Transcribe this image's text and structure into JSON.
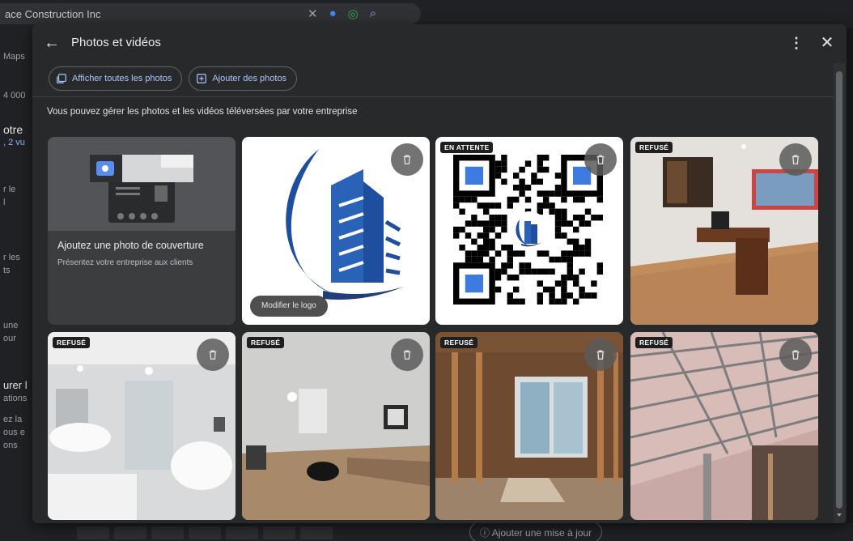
{
  "background": {
    "search_text": "ace Construction Inc",
    "left_fragments": [
      "Maps",
      "4 000",
      "otre",
      ", 2 vu",
      "r le",
      "l",
      "r les",
      "ts",
      "une",
      "our",
      "urer l",
      "ations",
      "ez la",
      "ous e",
      "ons"
    ],
    "bottom_button": "Ajouter une mise à jour"
  },
  "dialog": {
    "title": "Photos et vidéos",
    "chips": {
      "show_all": "Afficher toutes les photos",
      "add_photos": "Ajouter des photos"
    },
    "description": "Vous pouvez gérer les photos et les vidéos téléversées par votre entreprise",
    "cover": {
      "title": "Ajoutez une photo de couverture",
      "subtitle": "Présentez votre entreprise aux clients"
    },
    "logo_button": "Modifier le logo",
    "status": {
      "pending": "EN ATTENTE",
      "refused": "REFUSÉ"
    }
  },
  "colors": {
    "accent": "#a8c7fa",
    "dialog_bg": "#28292a",
    "logo_blue": "#1e4f9e"
  }
}
